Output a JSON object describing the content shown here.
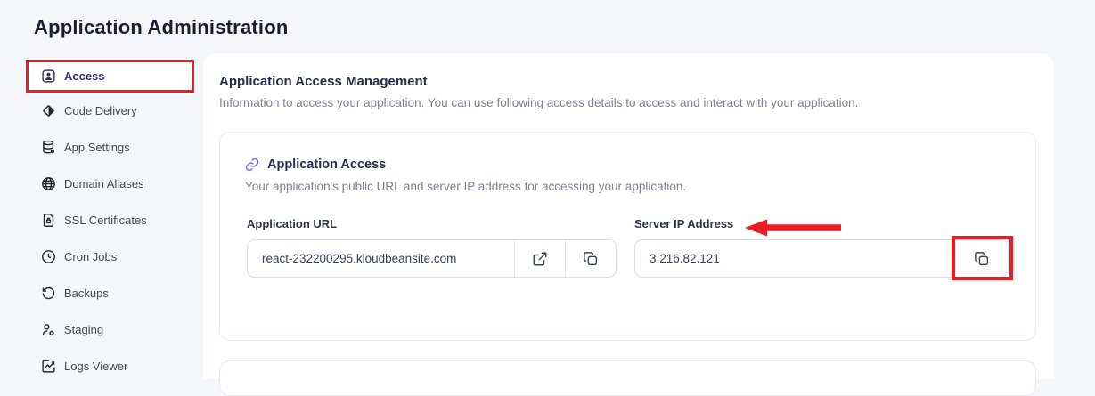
{
  "page": {
    "title": "Application Administration"
  },
  "sidebar": {
    "items": [
      {
        "label": "Access",
        "icon": "user-badge-icon",
        "active": true
      },
      {
        "label": "Code Delivery",
        "icon": "diamond-icon",
        "active": false
      },
      {
        "label": "App Settings",
        "icon": "database-icon",
        "active": false
      },
      {
        "label": "Domain Aliases",
        "icon": "globe-icon",
        "active": false
      },
      {
        "label": "SSL Certificates",
        "icon": "file-lock-icon",
        "active": false
      },
      {
        "label": "Cron Jobs",
        "icon": "clock-icon",
        "active": false
      },
      {
        "label": "Backups",
        "icon": "rotate-icon",
        "active": false
      },
      {
        "label": "Staging",
        "icon": "user-gear-icon",
        "active": false
      },
      {
        "label": "Logs Viewer",
        "icon": "chart-line-icon",
        "active": false
      }
    ]
  },
  "main": {
    "heading": "Application Access Management",
    "description": "Information to access your application. You can use following access details to access and interact with your application.",
    "card": {
      "icon": "link-icon",
      "title": "Application Access",
      "description": "Your application's public URL and server IP address for accessing your application.",
      "fields": {
        "url": {
          "label": "Application URL",
          "value": "react-232200295.kloudbeansite.com",
          "buttons": [
            "external-link-icon",
            "copy-icon"
          ]
        },
        "ip": {
          "label": "Server IP Address",
          "value": "3.216.82.121",
          "buttons": [
            "copy-icon"
          ]
        }
      }
    }
  },
  "annotations": {
    "color": "#ec1c24",
    "items": [
      "box-around-access-sidebar-item",
      "arrow-pointing-at-server-ip-label",
      "box-around-ip-copy-button"
    ]
  },
  "colors": {
    "page_background": "#f5f6fa",
    "panel_background": "#ffffff",
    "heading_text": "#242e49",
    "muted_text": "#7c8293",
    "active_sidebar_text": "#312e6b",
    "accent_purple": "#7c6cf0",
    "annotation_red": "#ec1c24"
  }
}
